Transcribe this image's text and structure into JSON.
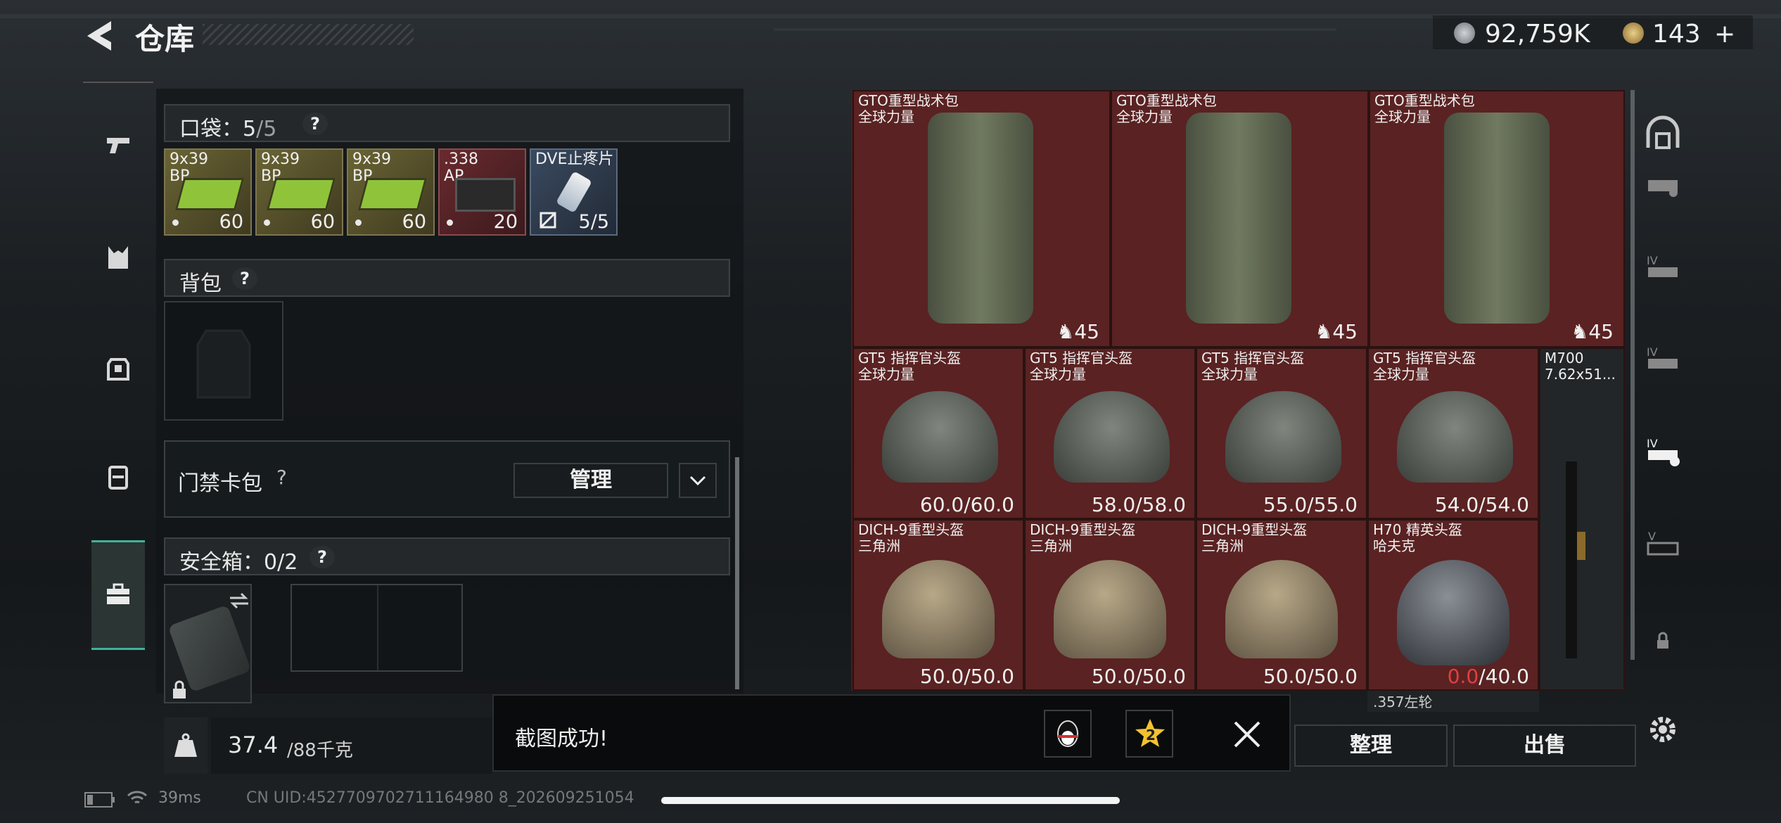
{
  "header": {
    "title": "仓库",
    "silver": "92,759K",
    "gold": "143",
    "plus": "+"
  },
  "left": {
    "pocket": {
      "label": "口袋：",
      "count": "5",
      "max": "/5",
      "help": "?"
    },
    "pocket_items": [
      {
        "name": "9x39\nBP",
        "count": "60"
      },
      {
        "name": "9x39\nBP",
        "count": "60"
      },
      {
        "name": "9x39\nBP",
        "count": "60"
      },
      {
        "name": ".338\nAP",
        "count": "20"
      },
      {
        "name": "DVE止疼片",
        "count": "5/5"
      }
    ],
    "backpack": {
      "label": "背包",
      "help": "?"
    },
    "keycard": {
      "label": "门禁卡包",
      "help": "?",
      "manage": "管理"
    },
    "safebox": {
      "label": "安全箱：0/2",
      "help": "?"
    },
    "weight": {
      "current": "37.4",
      "max": "/88千克",
      "unit_icon": "KG"
    }
  },
  "grid": {
    "backpacks": [
      {
        "name": "GTO重型战术包",
        "region": "全球力量",
        "capacity": "45"
      },
      {
        "name": "GTO重型战术包",
        "region": "全球力量",
        "capacity": "45"
      },
      {
        "name": "GTO重型战术包",
        "region": "全球力量",
        "capacity": "45"
      }
    ],
    "helmets_row1": [
      {
        "name": "GT5 指挥官头盔",
        "region": "全球力量",
        "durability": "60.0/60.0"
      },
      {
        "name": "GT5 指挥官头盔",
        "region": "全球力量",
        "durability": "58.0/58.0"
      },
      {
        "name": "GT5 指挥官头盔",
        "region": "全球力量",
        "durability": "55.0/55.0"
      },
      {
        "name": "GT5 指挥官头盔",
        "region": "全球力量",
        "durability": "54.0/54.0"
      }
    ],
    "helmets_row2": [
      {
        "name": "DICH-9重型头盔",
        "region": "三角洲",
        "durability": "50.0/50.0"
      },
      {
        "name": "DICH-9重型头盔",
        "region": "三角洲",
        "durability": "50.0/50.0"
      },
      {
        "name": "DICH-9重型头盔",
        "region": "三角洲",
        "durability": "50.0/50.0"
      },
      {
        "name": "H70 精英头盔",
        "region": "哈夫克",
        "durability_red": "0.0",
        "durability_max": "/40.0"
      }
    ],
    "rifle": {
      "name": "M700",
      "caliber": "7.62x51..."
    },
    "partial": ".357左轮"
  },
  "actions": {
    "sort": "整理",
    "sell": "出售"
  },
  "toast": {
    "text": "截图成功!",
    "badge": "2"
  },
  "status": {
    "ping": "39ms",
    "uid": "CN UID:4527709702711164980 8_202609251054"
  }
}
